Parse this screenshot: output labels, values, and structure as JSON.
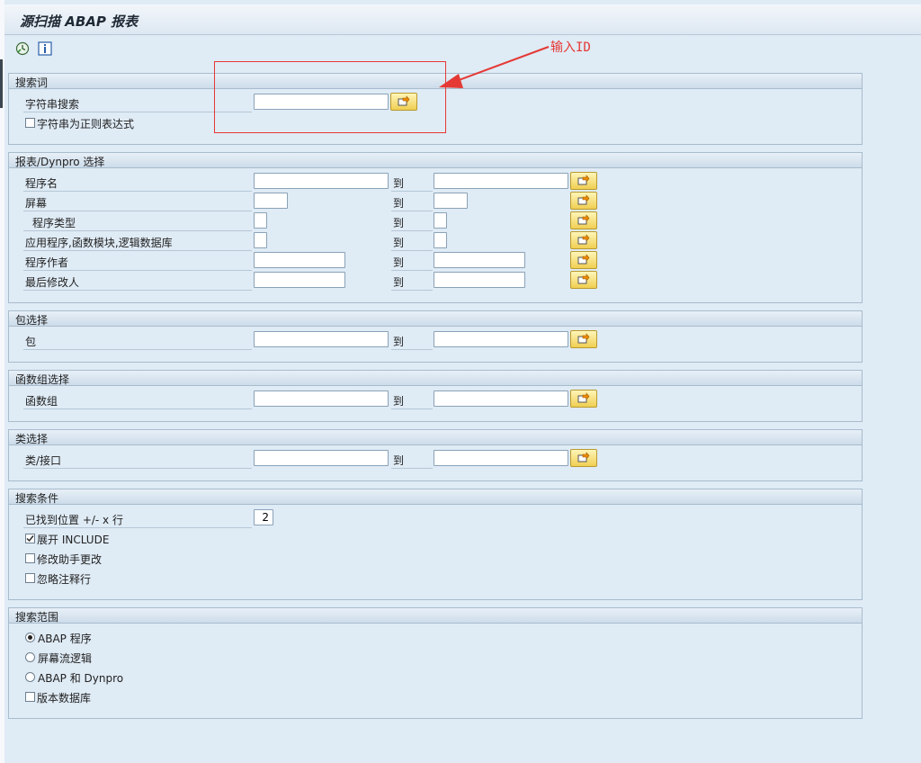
{
  "window": {
    "title": "源扫描 ABAP 报表"
  },
  "toolbar": {
    "execute_icon": "execute-clock-icon",
    "info_icon": "info-icon"
  },
  "search_term": {
    "title": "搜索词",
    "string_search_label": "字符串搜索",
    "string_search_value": "",
    "regex_label": "字符串为正则表达式",
    "regex_checked": false
  },
  "report_selection": {
    "title": "报表/Dynpro 选择",
    "to_label": "到",
    "rows": [
      {
        "label": "程序名",
        "from": "",
        "to": ""
      },
      {
        "label": "屏幕",
        "from": "",
        "to": ""
      },
      {
        "label": "程序类型",
        "from": "",
        "to": ""
      },
      {
        "label": "应用程序,函数模块,逻辑数据库",
        "from": "",
        "to": ""
      },
      {
        "label": "程序作者",
        "from": "",
        "to": ""
      },
      {
        "label": "最后修改人",
        "from": "",
        "to": ""
      }
    ]
  },
  "package_selection": {
    "title": "包选择",
    "label": "包",
    "to_label": "到",
    "from": "",
    "to": ""
  },
  "function_group_selection": {
    "title": "函数组选择",
    "label": "函数组",
    "to_label": "到",
    "from": "",
    "to": ""
  },
  "class_selection": {
    "title": "类选择",
    "label": "类/接口",
    "to_label": "到",
    "from": "",
    "to": ""
  },
  "search_criteria": {
    "title": "搜索条件",
    "lines_label": "已找到位置 +/- x 行",
    "lines_value": "2",
    "options": [
      {
        "label": "展开 INCLUDE",
        "checked": true
      },
      {
        "label": "修改助手更改",
        "checked": false
      },
      {
        "label": "忽略注释行",
        "checked": false
      }
    ]
  },
  "search_scope": {
    "title": "搜索范围",
    "radios": [
      {
        "label": "ABAP 程序",
        "selected": true
      },
      {
        "label": "屏幕流逻辑",
        "selected": false
      },
      {
        "label": "ABAP 和 Dynpro",
        "selected": false
      }
    ],
    "version_db_label": "版本数据库",
    "version_db_checked": false
  },
  "annotation": {
    "text": "输入ID",
    "color": "#e53935"
  },
  "colors": {
    "background": "#dfebf5",
    "button_yellow": "#f0cf52",
    "annotation_red": "#e53935"
  }
}
